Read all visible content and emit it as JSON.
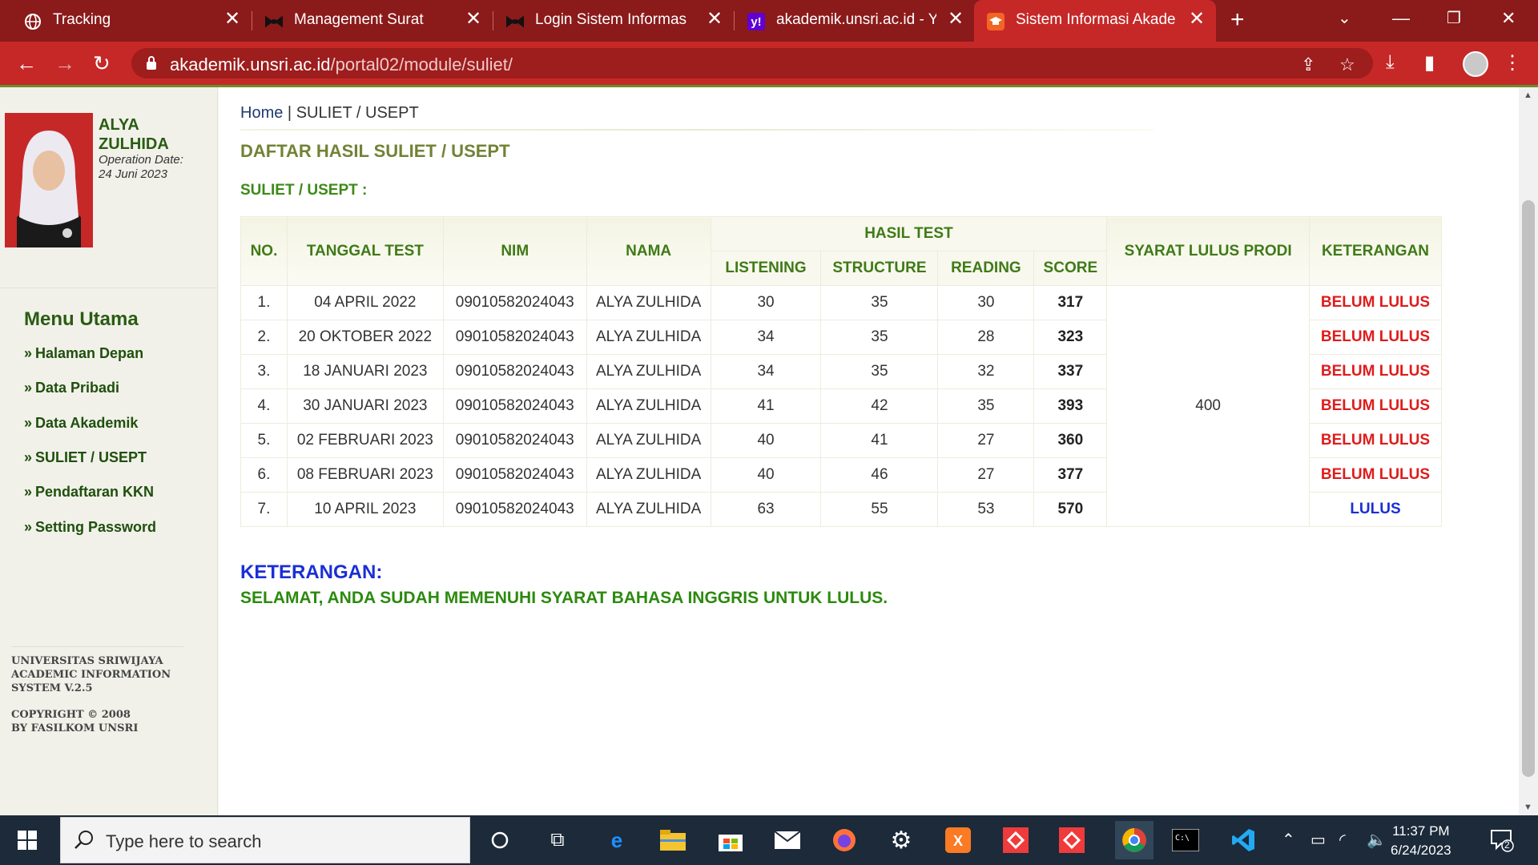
{
  "browser": {
    "tabs": [
      {
        "title": "Tracking",
        "icon": "globe-icon"
      },
      {
        "title": "Management Surat",
        "icon": "bowtie-icon"
      },
      {
        "title": "Login Sistem Informasi M",
        "icon": "bowtie-icon"
      },
      {
        "title": "akademik.unsri.ac.id - Yah",
        "icon": "yahoo-icon"
      },
      {
        "title": "Sistem Informasi Akadem",
        "icon": "graduation-cap-icon",
        "active": true
      }
    ],
    "url_host": "akademik.unsri.ac.id",
    "url_path": "/portal02/module/suliet/"
  },
  "profile": {
    "name_line1": "ALYA",
    "name_line2": "ZULHIDA",
    "operation_label": "Operation Date:",
    "operation_date": "24 Juni 2023"
  },
  "menu": {
    "title": "Menu Utama",
    "items": [
      "Halaman Depan",
      "Data Pribadi",
      "Data Akademik",
      "SULIET / USEPT",
      "Pendaftaran KKN",
      "Setting Password"
    ]
  },
  "footer": {
    "line1": "UNIVERSITAS SRIWIJAYA",
    "line2": "ACADEMIC INFORMATION",
    "line3": "SYSTEM V.2.5",
    "line4": "COPYRIGHT © 2008",
    "line5": "BY FASILKOM UNSRI"
  },
  "breadcrumb": {
    "home": "Home",
    "separator": "|",
    "current": "SULIET / USEPT"
  },
  "page_title": "DAFTAR HASIL SULIET / USEPT",
  "section_label": "SULIET / USEPT :",
  "table": {
    "headers": {
      "no": "NO.",
      "date": "TANGGAL TEST",
      "nim": "NIM",
      "name": "NAMA",
      "hasil": "HASIL TEST",
      "listening": "LISTENING",
      "structure": "STRUCTURE",
      "reading": "READING",
      "score": "SCORE",
      "syarat": "SYARAT LULUS PRODI",
      "keterangan": "KETERANGAN"
    },
    "syarat_value": "400",
    "rows": [
      {
        "no": "1.",
        "date": "04 APRIL 2022",
        "nim": "09010582024043",
        "name": "ALYA ZULHIDA",
        "listening": "30",
        "structure": "35",
        "reading": "30",
        "score": "317",
        "status": "BELUM LULUS"
      },
      {
        "no": "2.",
        "date": "20 OKTOBER 2022",
        "nim": "09010582024043",
        "name": "ALYA ZULHIDA",
        "listening": "34",
        "structure": "35",
        "reading": "28",
        "score": "323",
        "status": "BELUM LULUS"
      },
      {
        "no": "3.",
        "date": "18 JANUARI 2023",
        "nim": "09010582024043",
        "name": "ALYA ZULHIDA",
        "listening": "34",
        "structure": "35",
        "reading": "32",
        "score": "337",
        "status": "BELUM LULUS"
      },
      {
        "no": "4.",
        "date": "30 JANUARI 2023",
        "nim": "09010582024043",
        "name": "ALYA ZULHIDA",
        "listening": "41",
        "structure": "42",
        "reading": "35",
        "score": "393",
        "status": "BELUM LULUS"
      },
      {
        "no": "5.",
        "date": "02 FEBRUARI 2023",
        "nim": "09010582024043",
        "name": "ALYA ZULHIDA",
        "listening": "40",
        "structure": "41",
        "reading": "27",
        "score": "360",
        "status": "BELUM LULUS"
      },
      {
        "no": "6.",
        "date": "08 FEBRUARI 2023",
        "nim": "09010582024043",
        "name": "ALYA ZULHIDA",
        "listening": "40",
        "structure": "46",
        "reading": "27",
        "score": "377",
        "status": "BELUM LULUS"
      },
      {
        "no": "7.",
        "date": "10 APRIL 2023",
        "nim": "09010582024043",
        "name": "ALYA ZULHIDA",
        "listening": "63",
        "structure": "55",
        "reading": "53",
        "score": "570",
        "status": "LULUS"
      }
    ]
  },
  "note": {
    "title": "KETERANGAN:",
    "text": "SELAMAT, ANDA SUDAH MEMENUHI SYARAT BAHASA INGGRIS UNTUK LULUS."
  },
  "taskbar": {
    "search_placeholder": "Type here to search",
    "time": "11:37 PM",
    "date": "6/24/2023",
    "notification_count": "2"
  },
  "colors": {
    "chrome_dark": "#8b1a1a",
    "chrome": "#c62828",
    "menu_green": "#1f4f0c",
    "status_fail": "#e01b1b",
    "status_pass": "#1a2fd6"
  }
}
